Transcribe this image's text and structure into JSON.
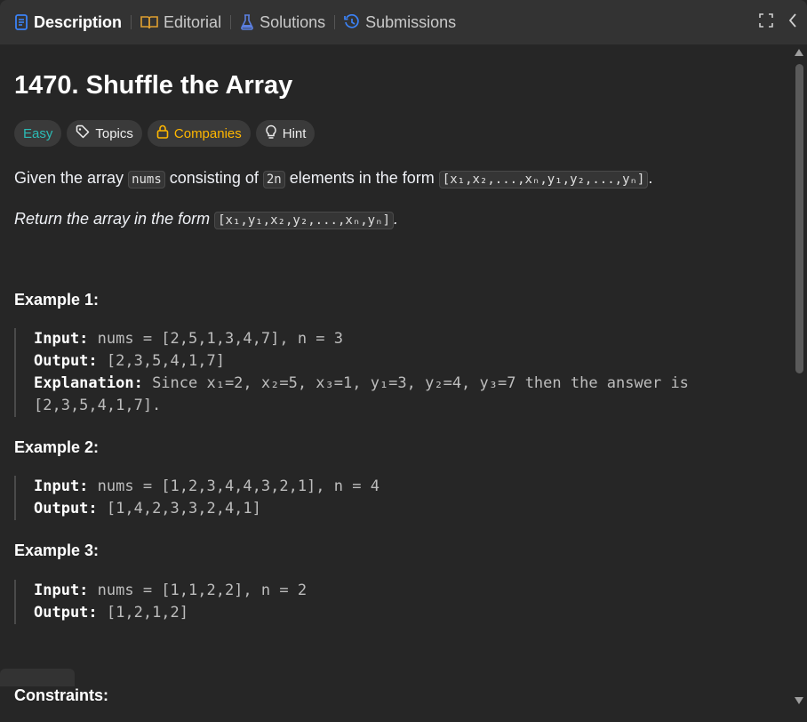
{
  "tabs": [
    {
      "label": "Description",
      "icon": "description-icon",
      "active": true
    },
    {
      "label": "Editorial",
      "icon": "book-icon"
    },
    {
      "label": "Solutions",
      "icon": "flask-icon"
    },
    {
      "label": "Submissions",
      "icon": "history-icon"
    }
  ],
  "problem": {
    "title": "1470. Shuffle the Array",
    "difficulty": "Easy",
    "pills": {
      "topics": "Topics",
      "companies": "Companies",
      "hint": "Hint"
    },
    "desc1": {
      "pre": "Given the array ",
      "code1": "nums",
      "mid1": " consisting of ",
      "code2": "2n",
      "mid2": " elements in the form ",
      "code3": "[x₁,x₂,...,xₙ,y₁,y₂,...,yₙ]",
      "end": "."
    },
    "desc2": {
      "pre": "Return the array in the form ",
      "code": "[x₁,y₁,x₂,y₂,...,xₙ,yₙ]",
      "end": "."
    }
  },
  "examples": [
    {
      "heading": "Example 1:",
      "input_label": "Input:",
      "input": " nums = [2,5,1,3,4,7], n = 3",
      "output_label": "Output:",
      "output": " [2,3,5,4,1,7]",
      "explanation_label": "Explanation:",
      "explanation": " Since x₁=2, x₂=5, x₃=1, y₁=3, y₂=4, y₃=7 then the answer is",
      "explanation2": "[2,3,5,4,1,7]."
    },
    {
      "heading": "Example 2:",
      "input_label": "Input:",
      "input": " nums = [1,2,3,4,4,3,2,1], n = 4",
      "output_label": "Output:",
      "output": " [1,4,2,3,3,2,4,1]"
    },
    {
      "heading": "Example 3:",
      "input_label": "Input:",
      "input": " nums = [1,1,2,2], n = 2",
      "output_label": "Output:",
      "output": " [1,2,1,2]"
    }
  ],
  "constraints_heading": "Constraints:",
  "colors": {
    "bg": "#262626",
    "tabbar": "#333333",
    "easy": "#2cbbb5",
    "companies": "#ffb700",
    "description_icon": "#3b82f6",
    "submissions_icon": "#3b82f6",
    "solutions_icon": "#5b7fe0"
  }
}
